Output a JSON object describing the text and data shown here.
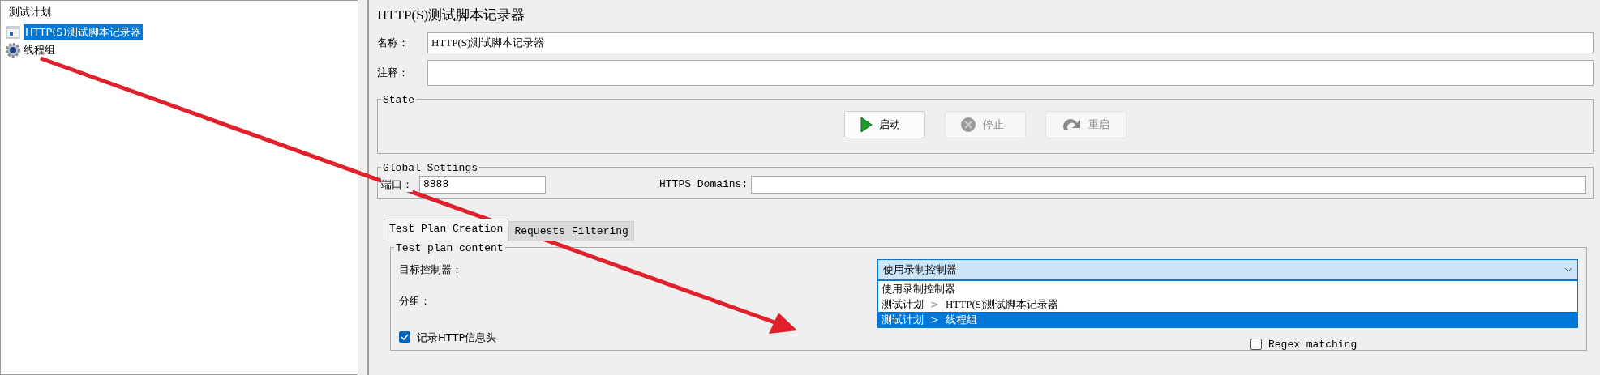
{
  "tree": {
    "root": "测试计划",
    "children": [
      {
        "label": "HTTP(S)测试脚本记录器",
        "kind": "recorder",
        "selected": true
      },
      {
        "label": "线程组",
        "kind": "thread-group",
        "selected": false
      }
    ]
  },
  "panel": {
    "title": "HTTP(S)测试脚本记录器",
    "fields": [
      {
        "label": "名称：",
        "value": "HTTP(S)测试脚本记录器"
      },
      {
        "label": "注释："
      }
    ]
  },
  "state": {
    "legend": "State",
    "buttons": [
      {
        "label": "启动",
        "kind": "start",
        "disabled": false
      },
      {
        "label": "停止",
        "kind": "stop",
        "disabled": true
      },
      {
        "label": "重启",
        "kind": "restart",
        "disabled": true
      }
    ]
  },
  "global_settings": {
    "legend": "Global Settings",
    "port_label": "端口：",
    "port_value": "8888",
    "domains_label": "HTTPS Domains:"
  },
  "tabs": [
    {
      "label": "Test Plan Creation",
      "selected": true
    },
    {
      "label": "Requests Filtering",
      "selected": false
    }
  ],
  "test_plan_content": {
    "legend": "Test plan content",
    "target_label": "目标控制器：",
    "target_value": "使用录制控制器",
    "expanded": true,
    "separator": ">",
    "options": [
      {
        "path": [
          "使用录制控制器"
        ],
        "selected": false
      },
      {
        "path": [
          "测试计划",
          "HTTP(S)测试脚本记录器"
        ],
        "selected": false
      },
      {
        "path": [
          "测试计划",
          "线程组"
        ],
        "selected": true
      }
    ],
    "group_label": "分组：",
    "checkboxes": [
      {
        "label": "记录HTTP信息头",
        "checked": true
      },
      {
        "label": "Regex matching",
        "checked": false
      }
    ]
  },
  "annotation": {
    "kind": "arrow"
  }
}
